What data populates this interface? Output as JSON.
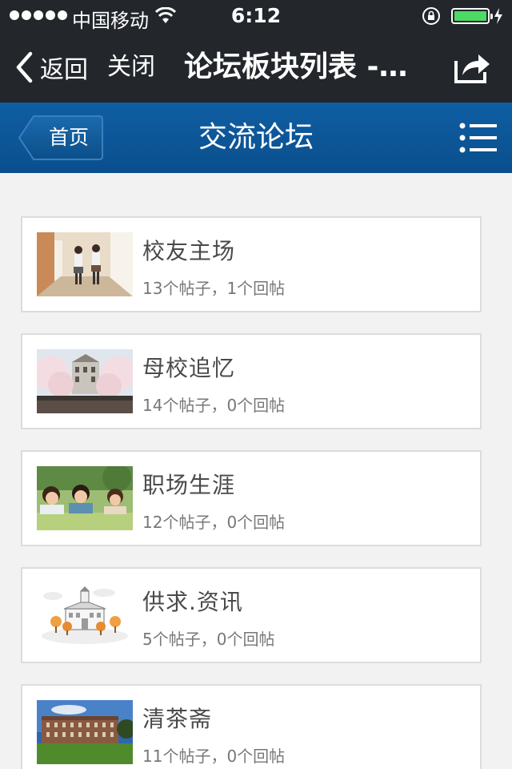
{
  "status_bar": {
    "carrier": "中国移动",
    "time": "6:12",
    "battery_level": 1.0,
    "battery_color": "#4cd964"
  },
  "nav": {
    "back_label": "返回",
    "close_label": "关闭",
    "title": "论坛板块列表 -…",
    "share_icon": "share-icon"
  },
  "header": {
    "home_label": "首页",
    "title": "交流论坛",
    "menu_icon": "list-menu-icon",
    "color": "#0f5ea3"
  },
  "forums": [
    {
      "title": "校友主场",
      "stats": "13个帖子，1个回帖",
      "thumb": "students-corridor-photo"
    },
    {
      "title": "母校追忆",
      "stats": "14个帖子，0个回帖",
      "thumb": "campus-cherry-blossom-photo"
    },
    {
      "title": "职场生涯",
      "stats": "12个帖子，0个回帖",
      "thumb": "students-on-grass-photo"
    },
    {
      "title": "供求.资讯",
      "stats": "5个帖子，0个回帖",
      "thumb": "building-illustration"
    },
    {
      "title": "清茶斋",
      "stats": "11个帖子，0个回帖",
      "thumb": "campus-building-photo"
    }
  ]
}
